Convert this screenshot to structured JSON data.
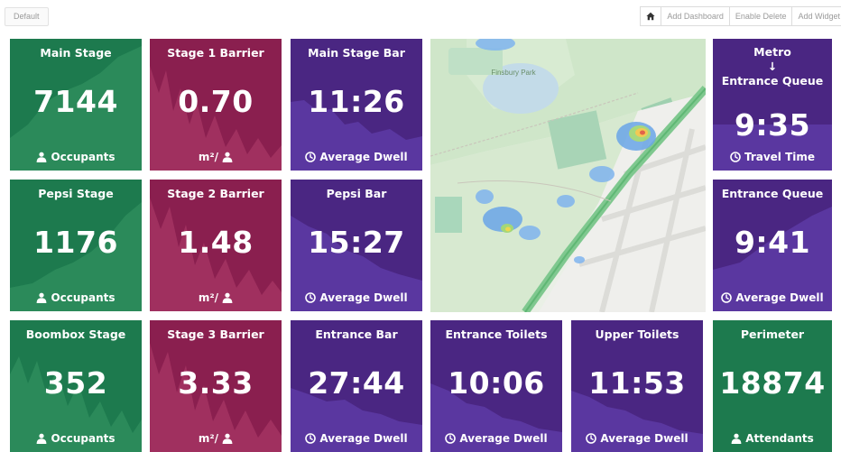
{
  "topbar": {
    "tab_label": "Default",
    "buttons": [
      "Add Dashboard",
      "Enable Delete",
      "Add Widget"
    ]
  },
  "colors": {
    "green": "#1d7a4e",
    "maroon": "#8a1f4f",
    "purple": "#4a2682"
  },
  "tiles": {
    "main_stage": {
      "title": "Main Stage",
      "value": "7144",
      "footer": "Occupants"
    },
    "stage1_barrier": {
      "title": "Stage 1 Barrier",
      "value": "0.70",
      "footer": "m²/"
    },
    "main_stage_bar": {
      "title": "Main Stage Bar",
      "value": "11:26",
      "footer": "Average Dwell"
    },
    "metro": {
      "title": "Metro",
      "arrow": "↓",
      "subtitle": "Entrance Queue",
      "value": "9:35",
      "footer": "Travel Time"
    },
    "pepsi_stage": {
      "title": "Pepsi Stage",
      "value": "1176",
      "footer": "Occupants"
    },
    "stage2_barrier": {
      "title": "Stage 2 Barrier",
      "value": "1.48",
      "footer": "m²/"
    },
    "pepsi_bar": {
      "title": "Pepsi Bar",
      "value": "15:27",
      "footer": "Average Dwell"
    },
    "entrance_queue": {
      "title": "Entrance Queue",
      "value": "9:41",
      "footer": "Average Dwell"
    },
    "boombox_stage": {
      "title": "Boombox Stage",
      "value": "352",
      "footer": "Occupants"
    },
    "stage3_barrier": {
      "title": "Stage 3 Barrier",
      "value": "3.33",
      "footer": "m²/"
    },
    "entrance_bar": {
      "title": "Entrance Bar",
      "value": "27:44",
      "footer": "Average Dwell"
    },
    "entrance_toilets": {
      "title": "Entrance Toilets",
      "value": "10:06",
      "footer": "Average Dwell"
    },
    "upper_toilets": {
      "title": "Upper Toilets",
      "value": "11:53",
      "footer": "Average Dwell"
    },
    "perimeter": {
      "title": "Perimeter",
      "value": "18874",
      "footer": "Attendants"
    }
  },
  "map": {
    "park_label": "Finsbury Park"
  },
  "icons": [
    "home-icon",
    "person-icon",
    "clock-icon",
    "arrow-down-icon"
  ]
}
